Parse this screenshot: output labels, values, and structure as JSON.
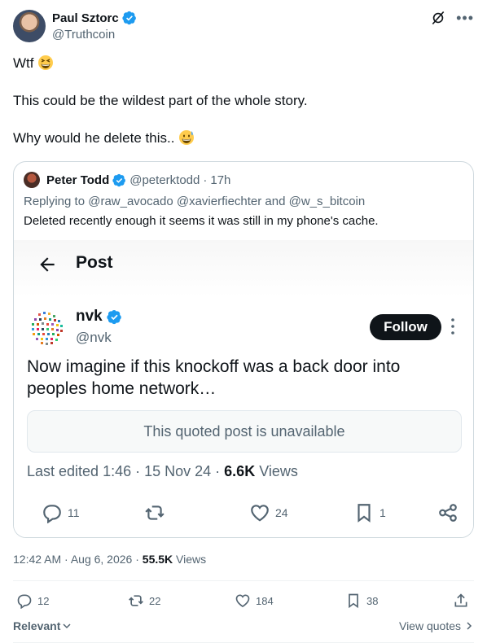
{
  "author": {
    "display_name": "Paul Sztorc",
    "handle": "@Truthcoin",
    "avatar_icon": "user-avatar"
  },
  "tweet": {
    "lines": [
      "Wtf",
      "This could be the wildest part of the whole story.",
      "Why would he delete this.."
    ]
  },
  "quote": {
    "author_name": "Peter Todd",
    "author_handle": "@peterktodd",
    "separator": "·",
    "time": "17h",
    "reply_prefix": "Replying to",
    "reply_to": "@raw_avocado @xavierfiechter and @w_s_bitcoin",
    "text": "Deleted recently enough it seems it was still in my phone's cache.",
    "screenshot": {
      "header_title": "Post",
      "name": "nvk",
      "handle": "@nvk",
      "follow_label": "Follow",
      "text": "Now imagine if this knockoff was a back door into peoples home network…",
      "unavailable_text": "This quoted post is unavailable",
      "edited_label": "Last edited 1:46 · 15 Nov 24 ·",
      "views_count": "6.6K",
      "views_label": "Views",
      "replies": "11",
      "likes": "24",
      "bookmarks": "1"
    }
  },
  "footer": {
    "time": "12:42 AM · Aug 6, 2026 ·",
    "views_count": "55.5K",
    "views_label": "Views",
    "replies": "12",
    "reposts": "22",
    "likes": "184",
    "bookmarks": "38",
    "sort_label": "Relevant",
    "view_quotes_label": "View quotes"
  },
  "colors": {
    "verified": "#1d9bf0",
    "text_primary": "#0f1419",
    "text_secondary": "#536471",
    "border": "#cfd9de"
  }
}
